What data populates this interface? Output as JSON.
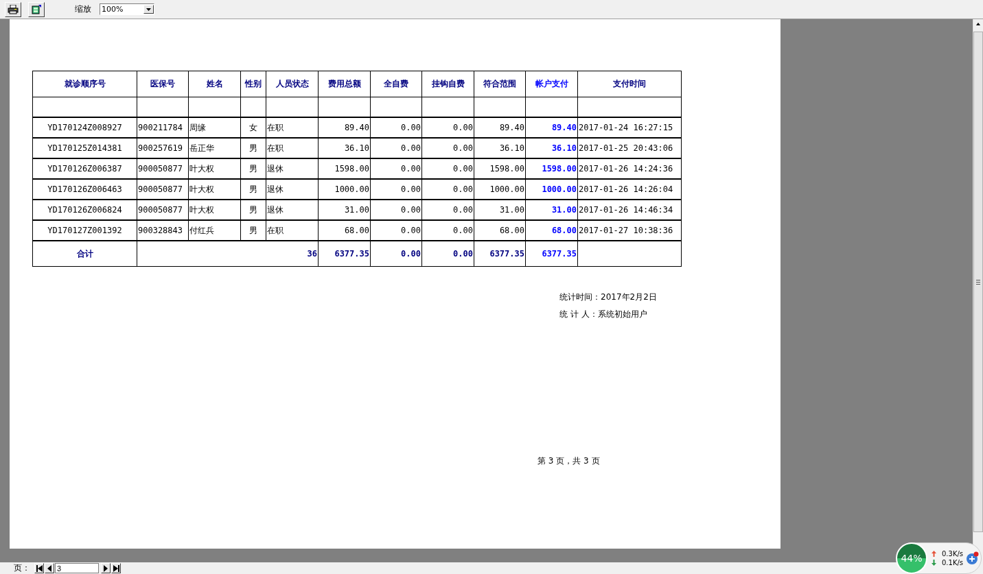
{
  "toolbar": {
    "zoom_label": "缩放",
    "zoom_value": "100%"
  },
  "report": {
    "columns": [
      {
        "label": "就诊顺序号",
        "kind": "id"
      },
      {
        "label": "医保号",
        "kind": "code"
      },
      {
        "label": "姓名",
        "kind": "name"
      },
      {
        "label": "性别",
        "kind": "sex"
      },
      {
        "label": "人员状态",
        "kind": "status"
      },
      {
        "label": "费用总额",
        "kind": "amount"
      },
      {
        "label": "全自费",
        "kind": "amount"
      },
      {
        "label": "挂钩自费",
        "kind": "amount"
      },
      {
        "label": "符合范围",
        "kind": "amount"
      },
      {
        "label": "帐户支付",
        "kind": "account"
      },
      {
        "label": "支付时间",
        "kind": "time"
      }
    ],
    "rows": [
      [
        "YD170124Z008927",
        "900211784",
        "周缘",
        "女",
        "在职",
        "89.40",
        "0.00",
        "0.00",
        "89.40",
        "89.40",
        "2017-01-24 16:27:15"
      ],
      [
        "YD170125Z014381",
        "900257619",
        "岳正华",
        "男",
        "在职",
        "36.10",
        "0.00",
        "0.00",
        "36.10",
        "36.10",
        "2017-01-25 20:43:06"
      ],
      [
        "YD170126Z006387",
        "900050877",
        "叶大权",
        "男",
        "退休",
        "1598.00",
        "0.00",
        "0.00",
        "1598.00",
        "1598.00",
        "2017-01-26 14:24:36"
      ],
      [
        "YD170126Z006463",
        "900050877",
        "叶大权",
        "男",
        "退休",
        "1000.00",
        "0.00",
        "0.00",
        "1000.00",
        "1000.00",
        "2017-01-26 14:26:04"
      ],
      [
        "YD170126Z006824",
        "900050877",
        "叶大权",
        "男",
        "退休",
        "31.00",
        "0.00",
        "0.00",
        "31.00",
        "31.00",
        "2017-01-26 14:46:34"
      ],
      [
        "YD170127Z001392",
        "900328843",
        "付红兵",
        "男",
        "在职",
        "68.00",
        "0.00",
        "0.00",
        "68.00",
        "68.00",
        "2017-01-27 10:38:36"
      ]
    ],
    "total": {
      "label": "合计",
      "count": "36",
      "values": [
        "6377.35",
        "0.00",
        "0.00",
        "6377.35",
        "6377.35"
      ]
    },
    "footer_lines": [
      "统计时间：2017年2月2日",
      "统 计 人：系统初始用户"
    ],
    "page_number": "第 3 页，共 3 页"
  },
  "pager": {
    "label": "页：",
    "value": "3"
  },
  "net_widget": {
    "percent": "44%",
    "upload": "0.3K/s",
    "download": "0.1K/s"
  }
}
